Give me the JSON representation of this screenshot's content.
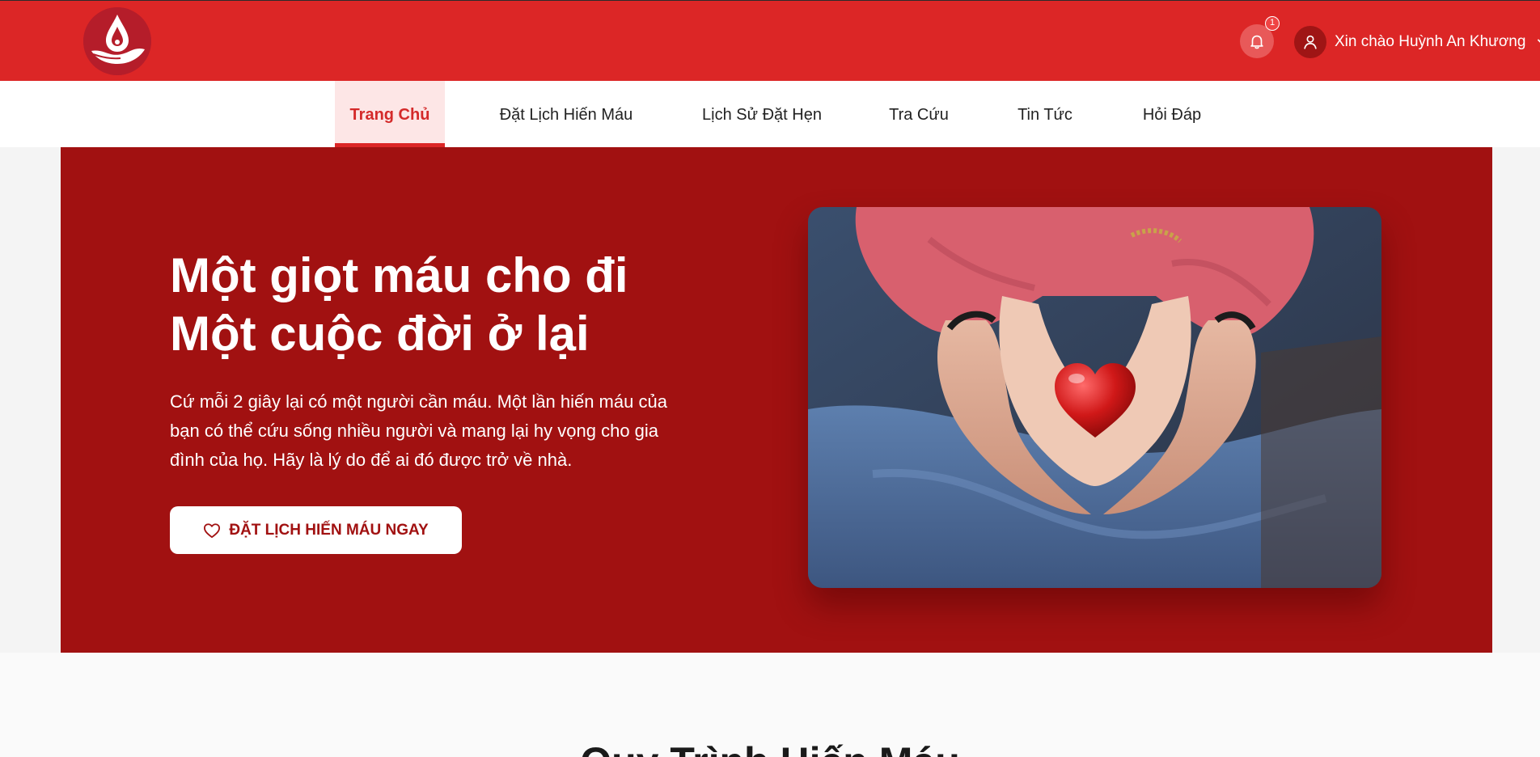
{
  "header": {
    "notification_count": "1",
    "greeting": "Xin chào Huỳnh An Khương"
  },
  "nav": {
    "items": [
      {
        "label": "Trang Chủ",
        "active": true
      },
      {
        "label": "Đặt Lịch Hiến Máu",
        "active": false
      },
      {
        "label": "Lịch Sử Đặt Hẹn",
        "active": false
      },
      {
        "label": "Tra Cứu",
        "active": false
      },
      {
        "label": "Tin Tức",
        "active": false
      },
      {
        "label": "Hỏi Đáp",
        "active": false
      }
    ]
  },
  "hero": {
    "title_line1": "Một giọt máu cho đi",
    "title_line2": "Một cuộc đời ở lại",
    "description": "Cứ mỗi 2 giây lại có một người cần máu. Một lần hiến máu của bạn có thể cứu sống nhiều người và mang lại hy vọng cho gia đình của họ. Hãy là lý do để ai đó được trở về nhà.",
    "cta_label": "ĐẶT LỊCH HIẾN MÁU NGAY"
  },
  "next_section": {
    "title": "Quy Trình Hiến Máu"
  },
  "icons": {
    "logo": "blood-drop-hand-logo",
    "bell": "bell-icon",
    "user": "user-icon",
    "chevron": "chevron-down-icon",
    "heart": "heart-icon"
  },
  "colors": {
    "header_red": "#dc2626",
    "hero_red": "#a11111",
    "active_tab_bg": "#fde6e6",
    "active_tab_text": "#d42a2a"
  }
}
